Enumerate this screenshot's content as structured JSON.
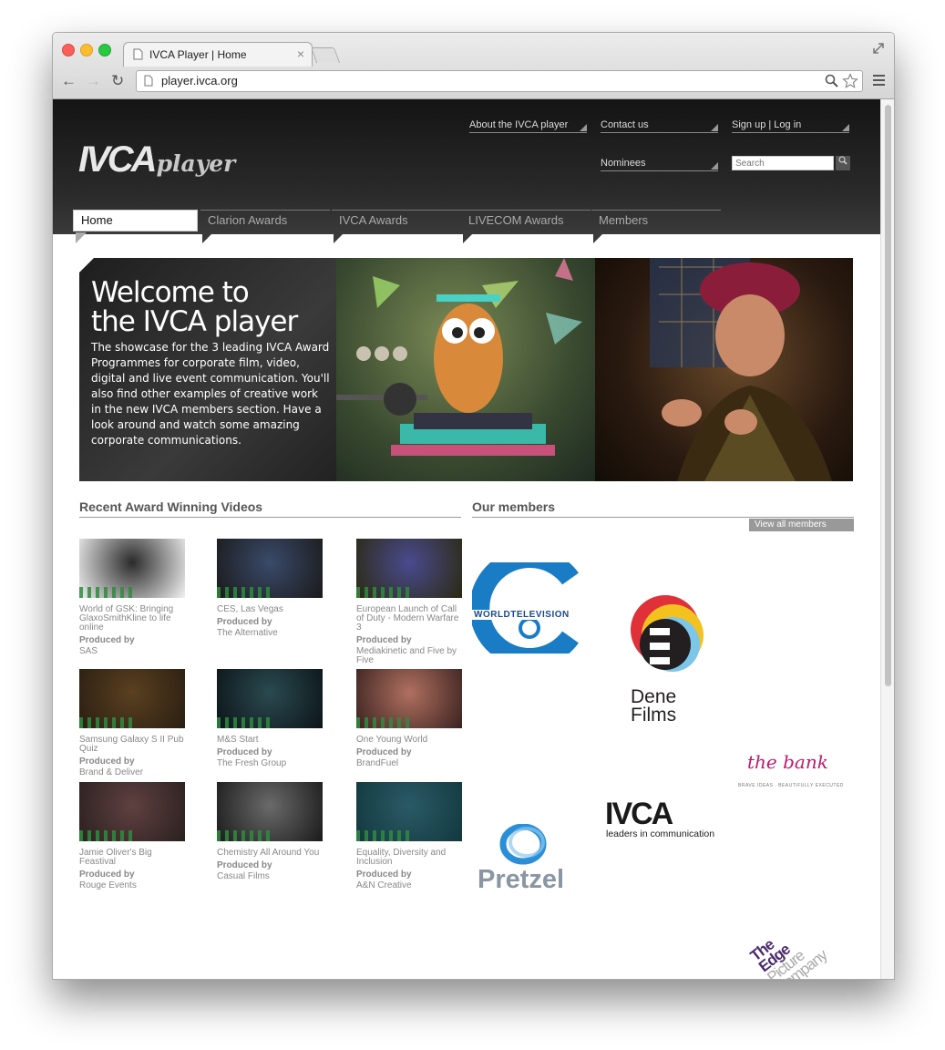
{
  "browser": {
    "tab_title": "IVCA Player | Home",
    "tab_close": "×",
    "url": "player.ivca.org"
  },
  "header": {
    "logo_ivca": "IVCA",
    "logo_player": "player",
    "links": {
      "about": "About the IVCA player",
      "contact": "Contact us",
      "signup": "Sign up",
      "separator": "|",
      "login": "Log in",
      "nominees": "Nominees"
    },
    "search_placeholder": "Search"
  },
  "nav": {
    "tabs": [
      "Home",
      "Clarion Awards",
      "IVCA Awards",
      "LIVECOM Awards",
      "Members"
    ],
    "active": "Home"
  },
  "hero": {
    "title_line1": "Welcome to",
    "title_line2": "the IVCA player",
    "body": "The showcase for the 3 leading IVCA Award Programmes for corporate film, video, digital and live event communication. You'll also find other examples of creative work in the new IVCA members section. Have a look around and watch some amazing corporate communications."
  },
  "videos": {
    "section_title": "Recent Award Winning Videos",
    "produced_by_label": "Produced by",
    "items": [
      {
        "title": "World of GSK: Bringing GlaxoSmithKline to life online",
        "producer": "SAS"
      },
      {
        "title": "CES, Las Vegas",
        "producer": "The Alternative"
      },
      {
        "title": "European Launch of Call of Duty - Modern Warfare 3",
        "producer": "Mediakinetic and Five by Five"
      },
      {
        "title": "Samsung Galaxy S II Pub Quiz",
        "producer": "Brand & Deliver"
      },
      {
        "title": "M&S Start",
        "producer": "The Fresh Group"
      },
      {
        "title": "One Young World",
        "producer": "BrandFuel"
      },
      {
        "title": "Jamie Oliver's Big Feastival",
        "producer": "Rouge Events"
      },
      {
        "title": "Chemistry All Around You",
        "producer": "Casual Films"
      },
      {
        "title": "Equality, Diversity and Inclusion",
        "producer": "A&N Creative"
      }
    ]
  },
  "members": {
    "section_title": "Our members",
    "view_all": "View all members",
    "logos": {
      "worldtv": "WORLDTELEVISION",
      "dene_line1": "Dene",
      "dene_line2": "Films",
      "bank": "the bank",
      "bank_tag": "BRAVE IDEAS . BEAUTIFULLY EXECUTED",
      "pretzel": "Pretzel",
      "ivca": "IVCA",
      "ivca_tag": "leaders in communication",
      "edge1": "The",
      "edge2": "Edge",
      "edge3": "Picture",
      "edge4": "Company"
    }
  },
  "colors": {
    "header_bg": "#1c1c1c",
    "worldtv_blue": "#1a7cc4",
    "pretzel_blue": "#2a8fd6",
    "bank_pink": "#c0186a",
    "edge_purple": "#4b2a6e"
  }
}
